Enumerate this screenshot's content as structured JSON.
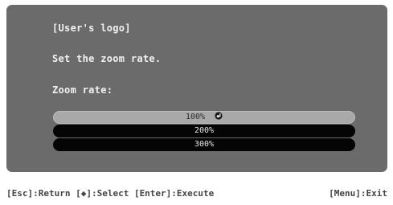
{
  "osd": {
    "title": "[User's logo]",
    "instruction": "Set the zoom rate.",
    "zoom_label": "Zoom rate:",
    "options": [
      {
        "label": "100%",
        "selected": true
      },
      {
        "label": "200%",
        "selected": false
      },
      {
        "label": "300%",
        "selected": false
      }
    ],
    "enter_icon": "enter-icon"
  },
  "help_bar": {
    "left": "[Esc]:Return [◆]:Select [Enter]:Execute",
    "right": "[Menu]:Exit"
  },
  "colors": {
    "panel": "#6b6b6b",
    "option_bg": "#050505",
    "selected_bg": "#a9a9a9",
    "text": "#f2f2f2"
  }
}
